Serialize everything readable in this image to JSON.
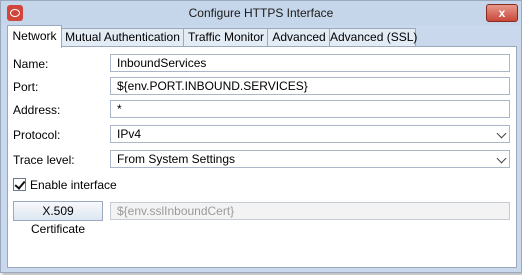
{
  "window": {
    "title": "Configure HTTPS Interface",
    "close_glyph": "x"
  },
  "tabs": [
    {
      "label": "Network",
      "active": true
    },
    {
      "label": "Mutual Authentication",
      "active": false
    },
    {
      "label": "Traffic Monitor",
      "active": false
    },
    {
      "label": "Advanced",
      "active": false
    },
    {
      "label": "Advanced (SSL)",
      "active": false
    }
  ],
  "form": {
    "name_label": "Name:",
    "name_value": "InboundServices",
    "port_label": "Port:",
    "port_value": "${env.PORT.INBOUND.SERVICES}",
    "address_label": "Address:",
    "address_value": "*",
    "protocol_label": "Protocol:",
    "protocol_value": "IPv4",
    "trace_label": "Trace level:",
    "trace_value": "From System Settings",
    "enable_label": "Enable interface",
    "enable_checked": true,
    "cert_button_label": "X.509 Certificate",
    "cert_value": "${env.sslInboundCert}"
  },
  "colors": {
    "frame": "#c9d8ec",
    "close_button": "#c9473a",
    "app_icon": "#d2453a"
  },
  "icons": {
    "app": "oracle-logo-icon",
    "close": "close-icon",
    "dropdown": "chevron-down-icon",
    "check": "checkmark-icon"
  }
}
